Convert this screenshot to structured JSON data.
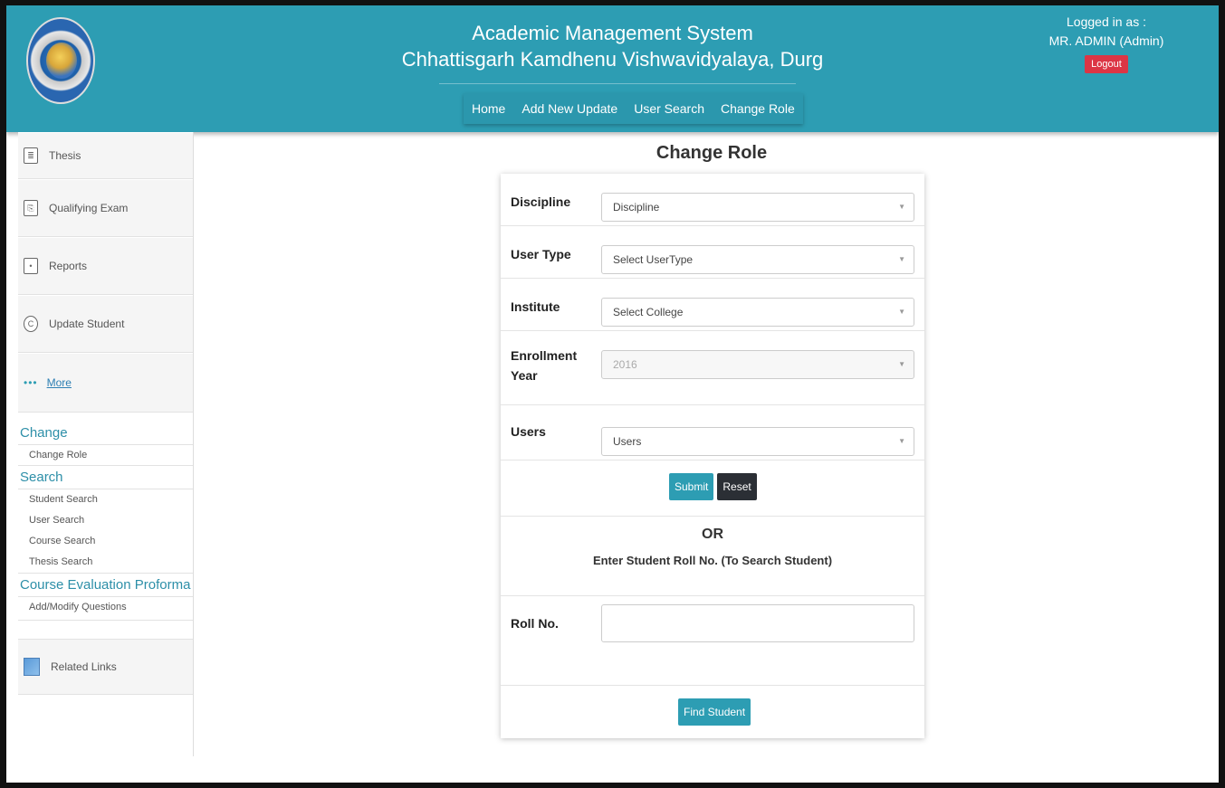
{
  "header": {
    "title1": "Academic Management System",
    "title2": "Chhattisgarh Kamdhenu Vishwavidyalaya, Durg",
    "nav": [
      "Home",
      "Add New Update",
      "User Search",
      "Change Role"
    ],
    "logged_in_label": "Logged in as :",
    "user": "MR. ADMIN (Admin)",
    "logout": "Logout",
    "bg_color": "#2d9db3"
  },
  "sidebar": {
    "items": [
      {
        "label": "Thesis",
        "icon": "document-icon"
      },
      {
        "label": "Qualifying Exam",
        "icon": "exam-icon"
      },
      {
        "label": "Reports",
        "icon": "report-icon"
      },
      {
        "label": "Update Student",
        "icon": "refresh-icon"
      }
    ],
    "more": "More",
    "groups": [
      {
        "title": "Change",
        "items": [
          "Change Role"
        ]
      },
      {
        "title": "Search",
        "items": [
          "Student Search",
          "User Search",
          "Course Search",
          "Thesis Search"
        ]
      },
      {
        "title": "Course Evaluation Proforma",
        "items": [
          "Add/Modify Questions"
        ]
      }
    ],
    "related": "Related Links"
  },
  "main": {
    "title": "Change Role",
    "fields": [
      {
        "label": "Discipline",
        "value": "Discipline"
      },
      {
        "label": "User Type",
        "value": "Select UserType"
      },
      {
        "label": "Institute",
        "value": "Select College"
      },
      {
        "label": "Enrollment Year",
        "value": "2016"
      },
      {
        "label": "Users",
        "value": "Users"
      }
    ],
    "submit": "Submit",
    "reset": "Reset",
    "or": "OR",
    "enter": "Enter Student Roll No. (To Search Student)",
    "roll_label": "Roll No.",
    "roll_value": "",
    "find": "Find Student"
  }
}
